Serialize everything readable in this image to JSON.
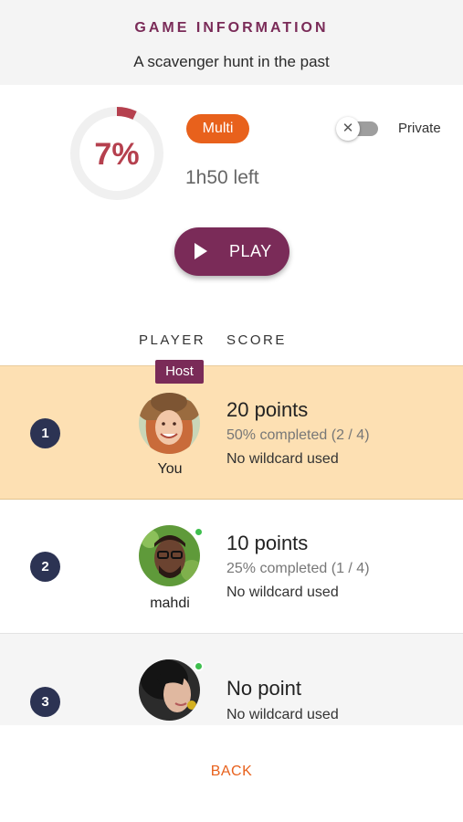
{
  "header": {
    "title": "GAME INFORMATION",
    "subtitle": "A scavenger hunt in the past"
  },
  "game": {
    "progress_text": "7%",
    "progress_fraction": 0.07,
    "mode_badge": "Multi",
    "private_label": "Private",
    "private_enabled": false,
    "time_left": "1h50 left",
    "play_label": "PLAY"
  },
  "table": {
    "col_player": "PLAYER",
    "col_score": "SCORE"
  },
  "players": [
    {
      "rank": "1",
      "name": "You",
      "host_badge": "Host",
      "points": "20 points",
      "progress": "50% completed (2 / 4)",
      "wildcard": "No wildcard used",
      "online": false
    },
    {
      "rank": "2",
      "name": "mahdi",
      "points": "10 points",
      "progress": "25% completed (1 / 4)",
      "wildcard": "No wildcard used",
      "online": true
    },
    {
      "rank": "3",
      "name": "",
      "points": "No point",
      "progress": "",
      "wildcard": "No wildcard used",
      "online": true
    }
  ],
  "footer": {
    "back_label": "BACK"
  },
  "colors": {
    "brand": "#7a2b58",
    "accent": "#e8611c",
    "highlight_row": "#fde0b3",
    "progress_ring": "#b5404e",
    "online": "#3ebf4e"
  }
}
